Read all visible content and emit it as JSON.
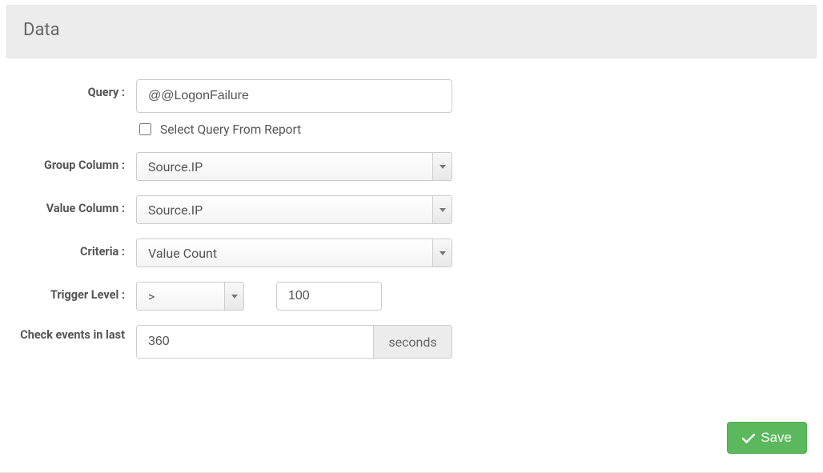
{
  "panel": {
    "title": "Data"
  },
  "labels": {
    "query": "Query :",
    "select_from_report": "Select Query From Report",
    "group_column": "Group Column :",
    "value_column": "Value Column :",
    "criteria": "Criteria :",
    "trigger_level": "Trigger Level :",
    "check_events": "Check events in last",
    "seconds": "seconds",
    "save": "Save"
  },
  "form": {
    "query_value": "@@LogonFailure",
    "select_from_report_checked": false,
    "group_column_selected": "Source.IP",
    "value_column_selected": "Source.IP",
    "criteria_selected": "Value Count",
    "trigger_operator": ">",
    "trigger_value": "100",
    "check_events_value": "360"
  }
}
